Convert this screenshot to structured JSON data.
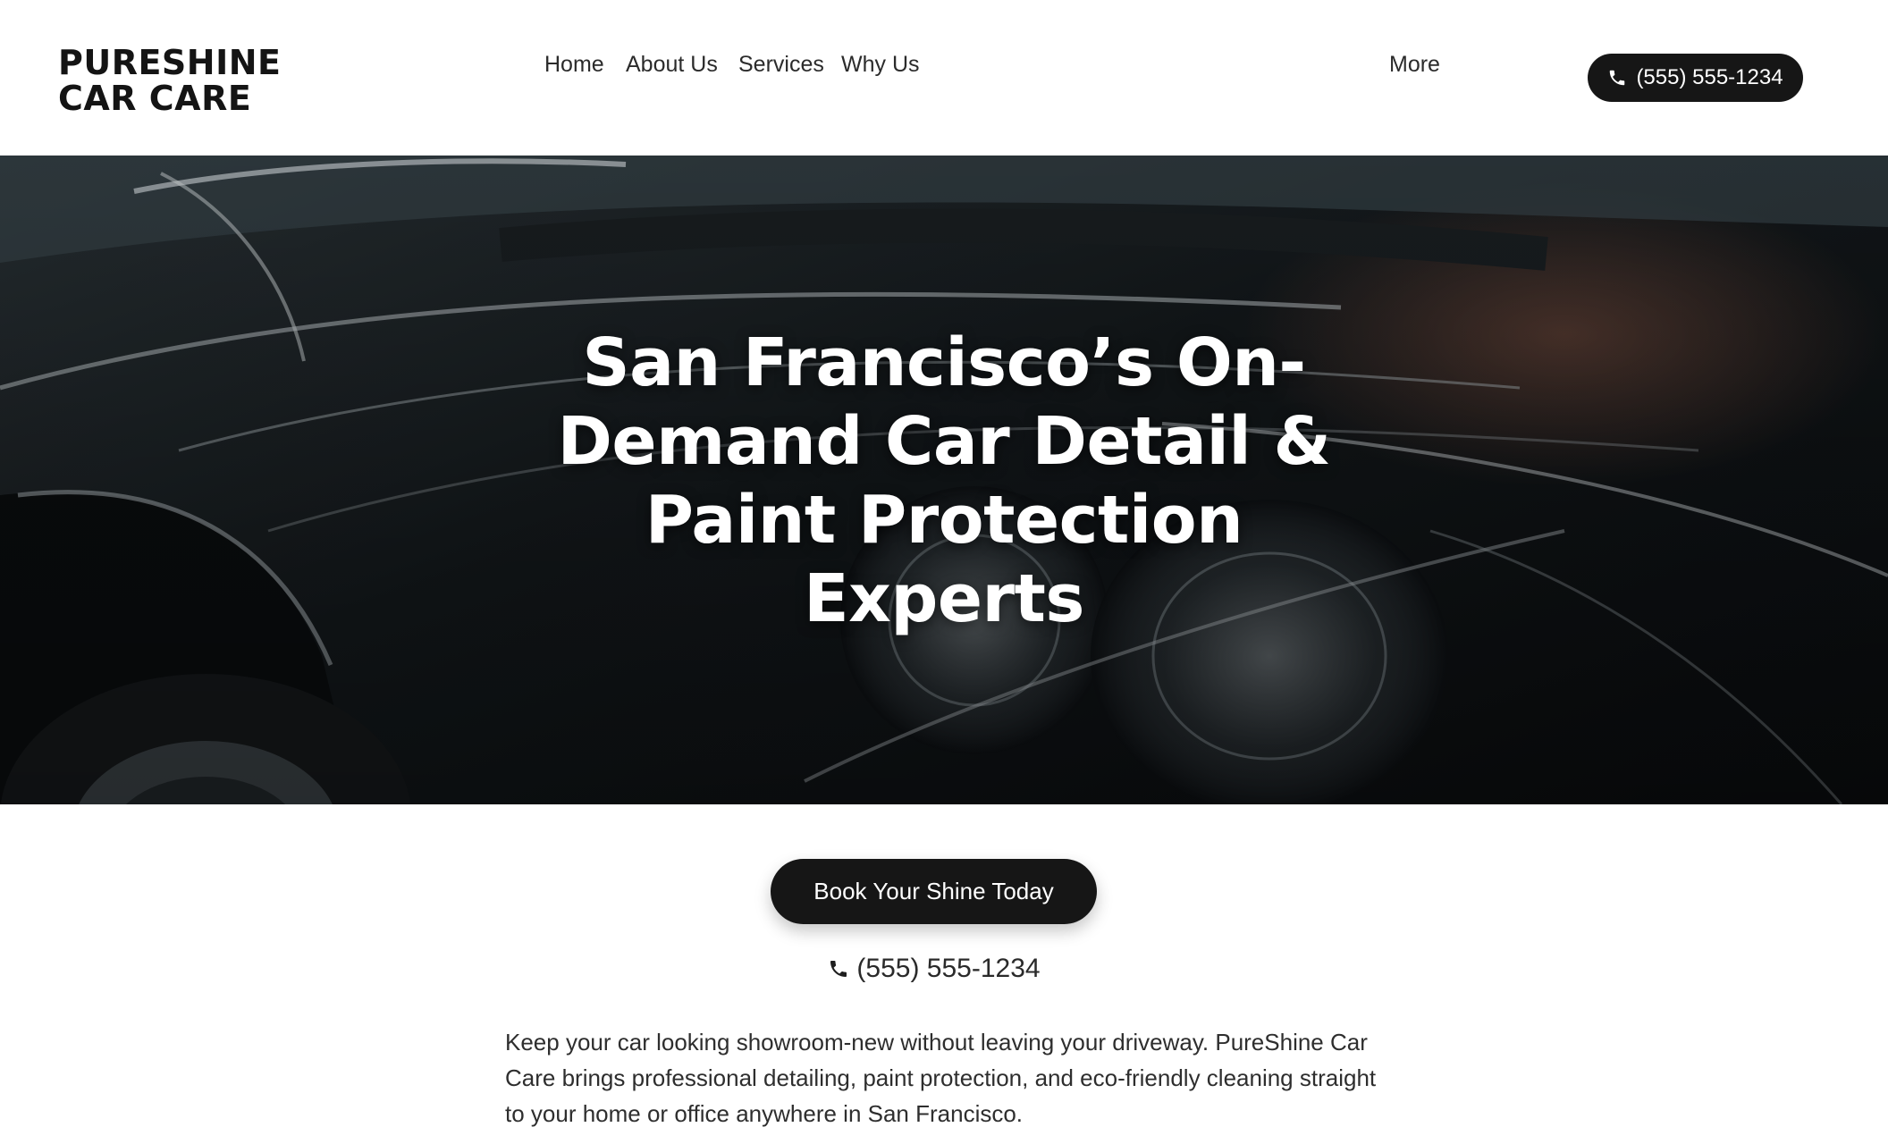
{
  "header": {
    "logo_line1": "PURESHINE",
    "logo_line2": "CAR CARE",
    "nav": [
      {
        "label": "Home"
      },
      {
        "label": "About Us"
      },
      {
        "label": "Services"
      },
      {
        "label": "Why Us"
      },
      {
        "label": "More"
      }
    ],
    "phone": "(555) 555-1234"
  },
  "hero": {
    "title": "San Francisco’s On-Demand Car Detail & Paint Protection Experts"
  },
  "content": {
    "cta_label": "Book Your Shine Today",
    "phone": "(555) 555-1234",
    "intro": "Keep your car looking showroom-new without leaving your driveway. PureShine Car Care brings professional detailing, paint protection, and eco-friendly cleaning straight to your home or office anywhere in San Francisco."
  },
  "icons": {
    "header_phone": "phone-icon",
    "content_phone": "phone-icon"
  },
  "colors": {
    "button_bg": "#161616",
    "text_dark": "#1a1a1a",
    "hero_bg": "#0d1114"
  }
}
